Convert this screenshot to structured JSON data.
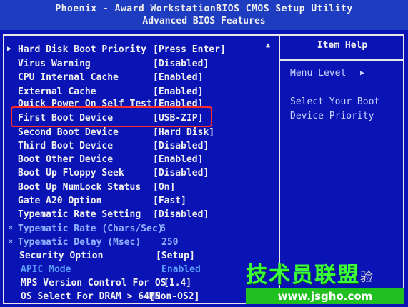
{
  "header": {
    "title": "Phoenix - Award WorkstationBIOS CMOS Setup Utility",
    "subtitle": "Advanced BIOS Features"
  },
  "settings": [
    {
      "label": "Hard Disk Boot Priority",
      "value": "[Press Enter]",
      "submenu": true
    },
    {
      "label": "Virus Warning",
      "value": "[Disabled]"
    },
    {
      "label": "CPU Internal Cache",
      "value": "[Enabled]"
    },
    {
      "label": "External Cache",
      "value": "[Enabled]"
    },
    {
      "label": "Quick Power On Self Test",
      "value": "[Enabled]"
    },
    {
      "label": "First Boot Device",
      "value": "[USB-ZIP]"
    },
    {
      "label": "Second Boot Device",
      "value": "[Hard Disk]"
    },
    {
      "label": "Third Boot Device",
      "value": "[Disabled]"
    },
    {
      "label": "Boot Other Device",
      "value": "[Enabled]"
    },
    {
      "label": "Boot Up Floppy Seek",
      "value": "[Disabled]"
    },
    {
      "label": "Boot Up NumLock Status",
      "value": "[On]"
    },
    {
      "label": "Gate A20 Option",
      "value": "[Fast]"
    },
    {
      "label": "Typematic Rate Setting",
      "value": "[Disabled]"
    },
    {
      "label": "Typematic Rate (Chars/Sec)",
      "value": "6",
      "dependent": true
    },
    {
      "label": "Typematic Delay (Msec)",
      "value": "250",
      "dependent": true
    },
    {
      "label": "Security Option",
      "value": "[Setup]"
    },
    {
      "label": "APIC Mode",
      "value": "Enabled",
      "readonly": true
    },
    {
      "label": "MPS Version Control For OS",
      "value": "[1.4]"
    },
    {
      "label": "OS Select For DRAM > 64MB",
      "value": "[Non-OS2]"
    }
  ],
  "help": {
    "title": "Item Help",
    "menu_level": "Menu Level",
    "text": "Select Your Boot Device Priority"
  },
  "watermark": {
    "cn": "技术员联盟",
    "extra": "验",
    "url": "www.jsgho.com"
  },
  "colors": {
    "background": "#0a14b4",
    "highlight": "#ff2a2a",
    "watermark_green": "#3cff3c"
  }
}
